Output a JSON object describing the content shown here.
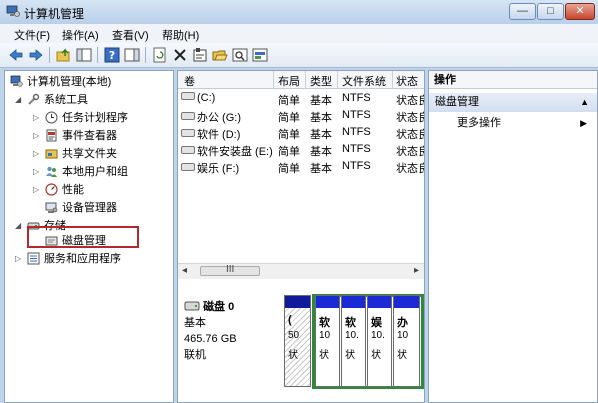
{
  "window": {
    "title": "计算机管理",
    "controls": {
      "minimize": "—",
      "maximize": "□",
      "close": "✕"
    }
  },
  "menu": [
    "文件(F)",
    "操作(A)",
    "查看(V)",
    "帮助(H)"
  ],
  "tree": {
    "root": "计算机管理(本地)",
    "system_tools": "系统工具",
    "task_scheduler": "任务计划程序",
    "event_viewer": "事件查看器",
    "shared_folders": "共享文件夹",
    "local_users": "本地用户和组",
    "performance": "性能",
    "device_manager": "设备管理器",
    "storage": "存储",
    "disk_management": "磁盘管理",
    "services_apps": "服务和应用程序"
  },
  "volumes": {
    "headers": [
      "卷",
      "布局",
      "类型",
      "文件系统",
      "状态"
    ],
    "rows": [
      [
        "(C:)",
        "简单",
        "基本",
        "NTFS",
        "状态良"
      ],
      [
        "办公 (G:)",
        "简单",
        "基本",
        "NTFS",
        "状态良"
      ],
      [
        "软件 (D:)",
        "简单",
        "基本",
        "NTFS",
        "状态良"
      ],
      [
        "软件安装盘 (E:)",
        "简单",
        "基本",
        "NTFS",
        "状态良"
      ],
      [
        "娱乐 (F:)",
        "简单",
        "基本",
        "NTFS",
        "状态良"
      ]
    ],
    "scroll_label": "III"
  },
  "disk": {
    "name": "磁盘 0",
    "type": "基本",
    "size": "465.76 GB",
    "status": "联机",
    "partitions": [
      {
        "t1": "(",
        "t2": "50",
        "t3": "状"
      },
      {
        "t1": "软",
        "t2": "10",
        "t3": "状"
      },
      {
        "t1": "软",
        "t2": "10.",
        "t3": "状"
      },
      {
        "t1": "娱",
        "t2": "10.",
        "t3": "状"
      },
      {
        "t1": "办",
        "t2": "10",
        "t3": "状"
      }
    ]
  },
  "actions": {
    "header": "操作",
    "section": "磁盘管理",
    "more": "更多操作"
  }
}
